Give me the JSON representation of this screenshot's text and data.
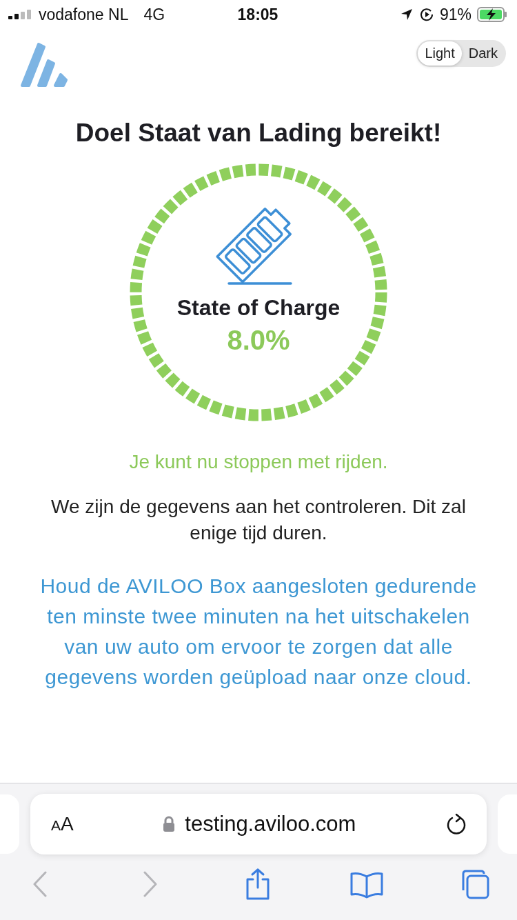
{
  "status_bar": {
    "carrier": "vodafone NL",
    "network": "4G",
    "time": "18:05",
    "battery": "91%"
  },
  "theme_toggle": [
    {
      "label": "Light",
      "selected": true
    },
    {
      "label": "Dark",
      "selected": false
    }
  ],
  "title": "Doel Staat van Lading bereikt!",
  "gauge": {
    "label": "State of Charge",
    "value": "8.0%"
  },
  "status_message": "Je kunt nu stoppen met rijden.",
  "info_text": "We zijn de gegevens aan het controleren. Dit zal enige tijd duren.",
  "notice_text": "Houd de AVILOO Box aangesloten gedurende ten minste twee minuten na het uitschakelen van uw auto om ervoor te zorgen dat alle gegevens worden geüpload naar onze cloud.",
  "browser": {
    "text_size_button": "AA",
    "url": "testing.aviloo.com",
    "toolbar": [
      {
        "kind": "back",
        "disabled": true
      },
      {
        "kind": "forward",
        "disabled": true
      },
      {
        "kind": "share",
        "disabled": false
      },
      {
        "kind": "bookmarks",
        "disabled": false
      },
      {
        "kind": "tabs",
        "disabled": false
      }
    ]
  }
}
